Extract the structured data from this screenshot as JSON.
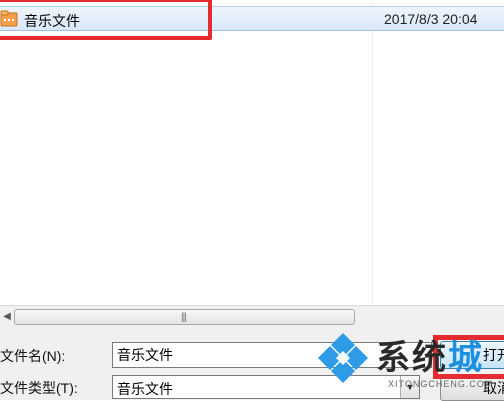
{
  "file_list": {
    "rows": [
      {
        "name": "音乐文件",
        "date": "2017/8/3 20:04",
        "icon": "music-folder-icon"
      }
    ]
  },
  "scrollbar": {
    "left_arrow": "◀",
    "grip": "|||"
  },
  "form": {
    "filename_label": "文件名(N):",
    "filename_value": "音乐文件",
    "filetype_label": "文件类型(T):",
    "filetype_value": "音乐文件",
    "open_button_label": "打开",
    "cancel_button_label": "取消"
  },
  "watermark": {
    "title_main": "系统",
    "title_accent": "城",
    "subtitle": "XITONGCHENG.COM"
  },
  "colors": {
    "highlight_box": "#e42b2f",
    "selection": "#d9e8fb",
    "accent_blue": "#1d8fe0"
  }
}
